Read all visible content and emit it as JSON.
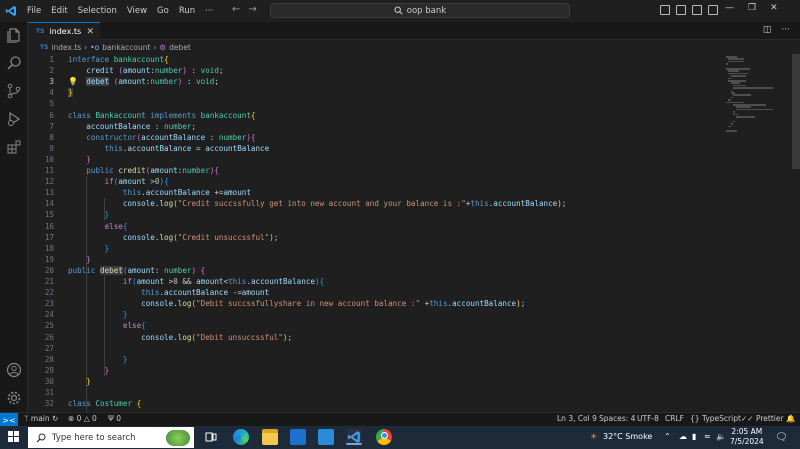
{
  "titlebar": {
    "menu": [
      "File",
      "Edit",
      "Selection",
      "View",
      "Go",
      "Run",
      "···"
    ],
    "search": "oop bank"
  },
  "tab": {
    "label": "index.ts",
    "badge": "TS"
  },
  "breadcrumb": {
    "badge": "TS",
    "file": "index.ts",
    "symbol1": "bankaccount",
    "symbol2": "debet"
  },
  "editor": {
    "line_numbers": [
      "1",
      "2",
      "3",
      "4",
      "5",
      "6",
      "7",
      "8",
      "9",
      "10",
      "11",
      "12",
      "13",
      "14",
      "15",
      "16",
      "17",
      "18",
      "19",
      "20",
      "21",
      "22",
      "23",
      "24",
      "25",
      "26",
      "27",
      "28",
      "29",
      "30",
      "31",
      "32"
    ],
    "active_line": 3
  },
  "code": {
    "l1": [
      "interface",
      "bankaccount",
      "{"
    ],
    "l2": [
      "credit",
      "(",
      "amount",
      ":",
      "number",
      ")",
      " : ",
      "void",
      ";"
    ],
    "l3": [
      "debet",
      "(",
      "amount",
      ":",
      "number",
      ")",
      " : ",
      "void",
      ";"
    ],
    "l4": [
      "}"
    ],
    "l6": [
      "class",
      "Bankaccount",
      "implements",
      "bankaccount",
      "{"
    ],
    "l7": [
      "accountBalance",
      " : ",
      "number",
      ";"
    ],
    "l8": [
      "constructor",
      "(",
      "accountBalance",
      " : ",
      "number",
      ")",
      "{"
    ],
    "l9": [
      "this",
      ".",
      "accountBalance",
      " = ",
      "accountBalance"
    ],
    "l10": [
      "}"
    ],
    "l11": [
      "public",
      "credit",
      "(",
      "amount",
      ":",
      "number",
      ")",
      "{"
    ],
    "l12": [
      "if",
      "(",
      "amount",
      " >",
      "0",
      ")",
      "{"
    ],
    "l13": [
      "this",
      ".",
      "accountBalance",
      " +=",
      "amount"
    ],
    "l14": [
      "console",
      ".",
      "log",
      "(",
      "\"Credit succssfully get into new account and your balance is :\"",
      "+",
      "this",
      ".",
      "accountBalance",
      ")",
      ";"
    ],
    "l15": [
      "}"
    ],
    "l16": [
      "else",
      "{"
    ],
    "l17": [
      "console",
      ".",
      "log",
      "(",
      "\"Credit unsuccssful\"",
      ")",
      ";"
    ],
    "l18": [
      "}"
    ],
    "l19": [
      "}"
    ],
    "l20": [
      "public",
      "debet",
      "(",
      "amount",
      ": ",
      "number",
      ")",
      " {"
    ],
    "l21": [
      "if",
      "(",
      "amount",
      " >",
      "0",
      " && ",
      "amount",
      "<",
      "this",
      ".",
      "accountBalance",
      ")",
      "{"
    ],
    "l22": [
      "this",
      ".",
      "accountBalance",
      " -=",
      "amount"
    ],
    "l23": [
      "console",
      ".",
      "log",
      "(",
      "\"Debit succssfullyshare in new account balance :\"",
      " +",
      "this",
      ".",
      "accountBalance",
      ")",
      ";"
    ],
    "l24": [
      "}"
    ],
    "l25": [
      "else",
      "{"
    ],
    "l26": [
      "console",
      ".",
      "log",
      "(",
      "\"Debit unsuccssful\"",
      ")",
      ";"
    ],
    "l28": [
      "}"
    ],
    "l29": [
      "}"
    ],
    "l30": [
      "}"
    ],
    "l32": [
      "class",
      "Costumer",
      " {"
    ]
  },
  "status": {
    "remote": "><",
    "branch": "main",
    "errors": "0",
    "warnings": "0",
    "ports": "0",
    "position": "Ln 3, Col 9",
    "spaces": "Spaces: 4",
    "encoding": "UTF-8",
    "eol": "CRLF",
    "language": "TypeScript",
    "formatter": "Prettier"
  },
  "taskbar": {
    "search_placeholder": "Type here to search",
    "weather": "32°C  Smoke",
    "time": "2:05 AM",
    "date": "7/5/2024"
  },
  "colors": {
    "accent": "#0078d4",
    "keyword": "#569cd6",
    "type": "#4ec9b0",
    "function": "#dcdcaa",
    "variable": "#9cdcfe",
    "string": "#ce9178",
    "number": "#b5cea8",
    "control": "#c586c0"
  },
  "icons": [
    "vscode-logo-icon",
    "explorer-icon",
    "search-icon",
    "source-control-icon",
    "run-debug-icon",
    "extensions-icon",
    "account-icon",
    "settings-gear-icon",
    "lightbulb-icon",
    "windows-start-icon",
    "edge-icon",
    "chrome-icon",
    "vscode-taskbar-icon",
    "file-explorer-icon",
    "mail-icon",
    "store-icon"
  ]
}
